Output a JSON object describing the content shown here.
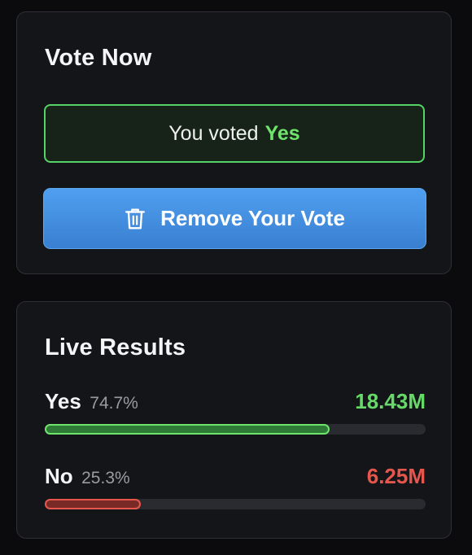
{
  "vote_card": {
    "title": "Vote Now",
    "voted_prefix": "You voted",
    "voted_choice": "Yes",
    "remove_label": "Remove Your Vote",
    "remove_icon": "trash-icon"
  },
  "results_card": {
    "title": "Live Results",
    "options": [
      {
        "label": "Yes",
        "percent_text": "74.7%",
        "percent": 74.7,
        "count": "18.43M",
        "color": "#6fe36c"
      },
      {
        "label": "No",
        "percent_text": "25.3%",
        "percent": 25.3,
        "count": "6.25M",
        "color": "#e5574d"
      }
    ]
  }
}
